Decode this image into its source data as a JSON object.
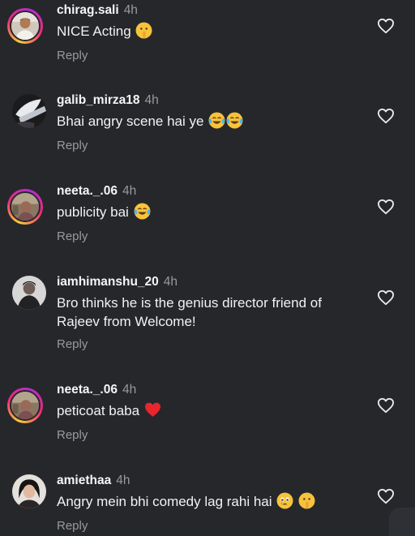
{
  "comments": [
    {
      "username": "chirag.sali",
      "time": "4h",
      "text": "NICE Acting",
      "emojis": [
        "shushing-face"
      ],
      "reply": "Reply",
      "avatar_ring": "story"
    },
    {
      "username": "galib_mirza18",
      "time": "4h",
      "text": "Bhai angry scene hai ye",
      "emojis": [
        "tears-of-joy-face",
        "tears-of-joy-face"
      ],
      "reply": "Reply",
      "avatar_ring": "none"
    },
    {
      "username": "neeta._.06",
      "time": "4h",
      "text": "publicity bai",
      "emojis": [
        "tears-of-joy-face"
      ],
      "reply": "Reply",
      "avatar_ring": "story"
    },
    {
      "username": "iamhimanshu_20",
      "time": "4h",
      "text": "Bro thinks he is the genius director friend of Rajeev from Welcome!",
      "emojis": [],
      "reply": "Reply",
      "avatar_ring": "none"
    },
    {
      "username": "neeta._.06",
      "time": "4h",
      "text": "peticoat baba",
      "emojis": [
        "red-heart"
      ],
      "reply": "Reply",
      "avatar_ring": "story"
    },
    {
      "username": "amiethaa",
      "time": "4h",
      "text": "Angry mein bhi comedy lag rahi hai ",
      "emojis": [
        "face-holding-back-tears",
        "shushing-face"
      ],
      "reply": "Reply",
      "avatar_ring": "none"
    }
  ],
  "icons": {
    "like": "heart-outline-icon"
  },
  "colors": {
    "background": "#26272b",
    "secondary_text": "#9a9a9e",
    "story_ring_start": "#f9ce34",
    "story_ring_end": "#ee2a7b"
  }
}
